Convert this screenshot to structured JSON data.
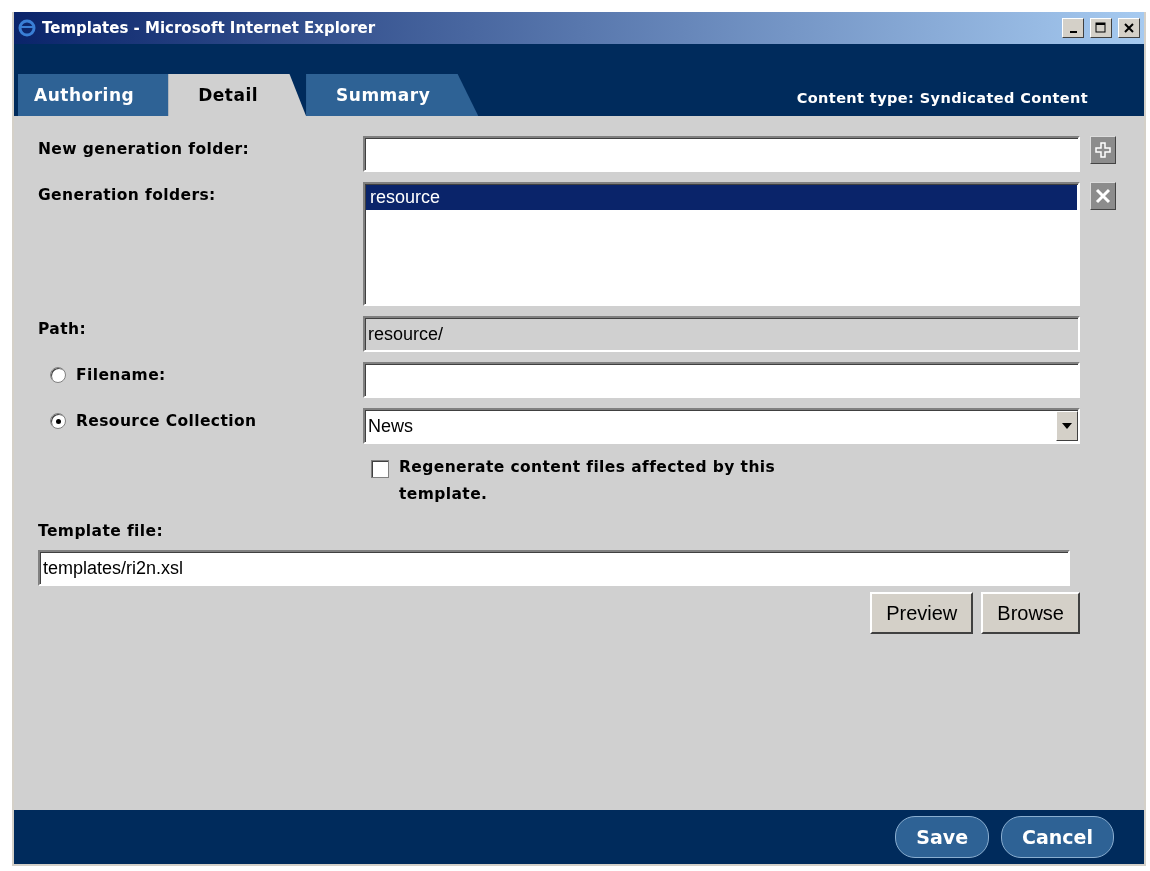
{
  "window": {
    "title": "Templates - Microsoft Internet Explorer"
  },
  "tabs": [
    {
      "label": "Authoring",
      "selected": false
    },
    {
      "label": "Detail",
      "selected": true
    },
    {
      "label": "Summary",
      "selected": false
    }
  ],
  "content_type": "Content type: Syndicated Content",
  "new_folder": {
    "label": "New generation folder:"
  },
  "folders": {
    "label": "Generation folders:",
    "items": [
      {
        "label": "resource",
        "selected": true
      }
    ]
  },
  "path": {
    "label": "Path:",
    "value": "resource/"
  },
  "target": [
    {
      "kind": "text",
      "label": "Filename:",
      "selected": false
    },
    {
      "kind": "select",
      "label": "Resource Collection",
      "value": "News",
      "selected": true
    }
  ],
  "regenerate": {
    "label": "Regenerate content files affected by this template.",
    "checked": false
  },
  "template_file": {
    "label": "Template file:",
    "value": "templates/ri2n.xsl"
  },
  "file_buttons": [
    "Preview",
    "Browse"
  ],
  "footer_buttons": [
    "Save",
    "Cancel"
  ]
}
